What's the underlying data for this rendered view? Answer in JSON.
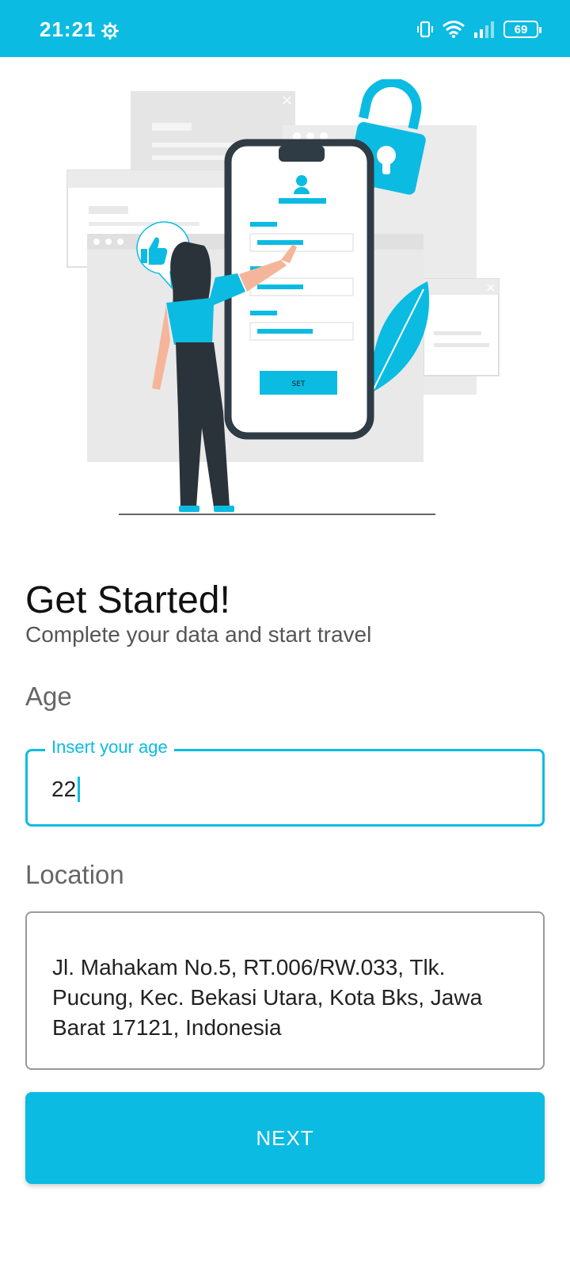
{
  "status_bar": {
    "time": "21:21",
    "battery": "69",
    "icons": [
      "gear-icon",
      "vibrate-icon",
      "wifi-icon",
      "signal-icon",
      "battery-icon"
    ]
  },
  "illustration": {
    "button_text": "SET",
    "icons": [
      "user-icon",
      "thumbs-up-icon",
      "lock-icon",
      "leaf-icon"
    ]
  },
  "header": {
    "title": "Get Started!",
    "subtitle": "Complete your data and start travel"
  },
  "form": {
    "age_label": "Age",
    "age_placeholder": "Insert your age",
    "age_value": "22",
    "location_label": "Location",
    "location_value": "Jl. Mahakam No.5, RT.006/RW.033, Tlk. Pucung, Kec. Bekasi Utara, Kota Bks, Jawa Barat 17121, Indonesia"
  },
  "actions": {
    "next_label": "NEXT"
  },
  "colors": {
    "accent": "#0bbbe2",
    "illustration_dark": "#2b333a",
    "illustration_gray": "#e8e8e8"
  }
}
